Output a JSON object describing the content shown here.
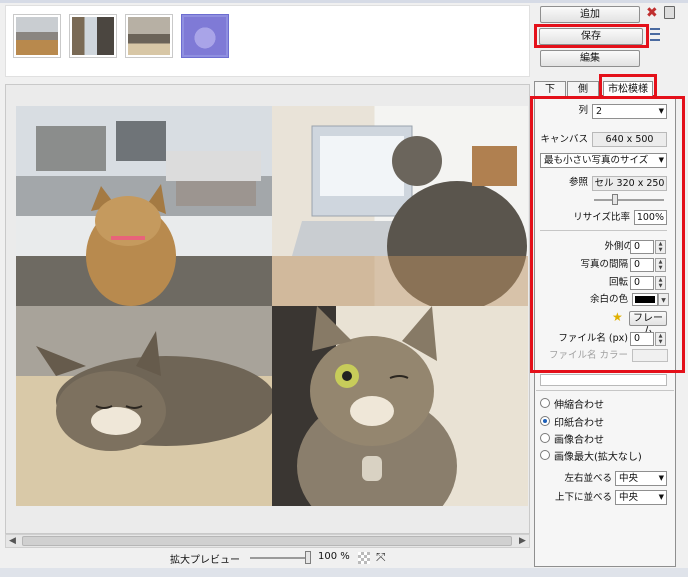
{
  "thumbnails": [
    "thumb-cat-snow-roof",
    "thumb-cat-laptop",
    "thumb-cat-sleeping",
    "thumb-cat-face-selected"
  ],
  "toolbar": {
    "add_label": "追加",
    "save_label": "保存",
    "edit_label": "編集"
  },
  "tabs": [
    {
      "label": "下"
    },
    {
      "label": "側"
    },
    {
      "label": "市松模様"
    }
  ],
  "settings": {
    "columns_label": "列",
    "columns_value": "2",
    "canvas_label": "キャンバス",
    "canvas_value": "640 x 500",
    "size_mode": "最も小さい写真のサイズ",
    "ref_label": "参照",
    "ref_value": "セル 320 x 250",
    "resize_label": "リサイズ比率",
    "resize_value": "100%",
    "outer_margin_label": "外側の余白",
    "outer_margin_value": "0",
    "spacing_label": "写真の間隔",
    "spacing_value": "0",
    "rotate_label": "回転",
    "rotate_value": "0",
    "margin_color_label": "余白の色",
    "frame_label": "フレーム",
    "filename_label": "ファイル名 (px)",
    "filename_value": "0",
    "filename_color_label": "ファイル名 カラー"
  },
  "fit_options": [
    {
      "label": "伸縮合わせ",
      "selected": false
    },
    {
      "label": "印紙合わせ",
      "selected": true
    },
    {
      "label": "画像合わせ",
      "selected": false
    },
    {
      "label": "画像最大(拡大なし)",
      "selected": false
    }
  ],
  "align": {
    "h_label": "左右並べる",
    "h_value": "中央",
    "v_label": "上下に並べる",
    "v_value": "中央"
  },
  "preview": {
    "zoom_label": "拡大プレビュー",
    "zoom_value": "100 %"
  },
  "colors": {
    "highlight": "#e4101a",
    "margin_color": "#000000",
    "selected_thumb": "#8f8fe0"
  }
}
